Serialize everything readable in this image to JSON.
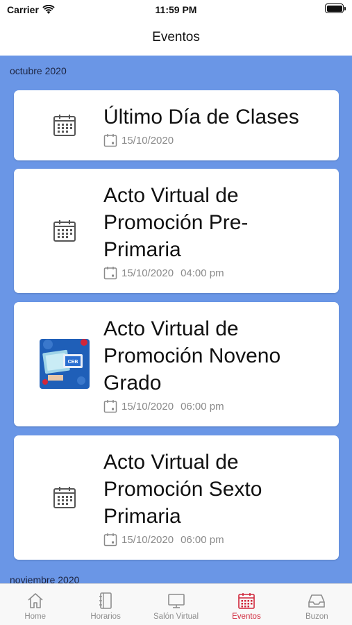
{
  "status_bar": {
    "carrier": "Carrier",
    "time": "11:59 PM"
  },
  "nav": {
    "title": "Eventos"
  },
  "colors": {
    "list_background": "#6a96e6",
    "active_tab": "#d0263a",
    "inactive_tab": "#8e8e8e"
  },
  "sections": [
    {
      "title": "octubre 2020"
    },
    {
      "title": "noviembre 2020"
    }
  ],
  "events": [
    {
      "title": "Último Día de Clases",
      "date": "15/10/2020",
      "time": "",
      "icon": "calendar-icon"
    },
    {
      "title": "Acto Virtual de Promoción Pre-Primaria",
      "date": "15/10/2020",
      "time": "04:00 pm",
      "icon": "calendar-icon"
    },
    {
      "title": "Acto Virtual de Promoción Noveno Grado",
      "date": "15/10/2020",
      "time": "06:00 pm",
      "icon": "event-image-thumbnail",
      "thumb_text": "CEB"
    },
    {
      "title": "Acto Virtual de Promoción Sexto Primaria",
      "date": "15/10/2020",
      "time": "06:00 pm",
      "icon": "calendar-icon"
    }
  ],
  "tabs": [
    {
      "label": "Home",
      "icon": "home-icon",
      "active": false
    },
    {
      "label": "Horarios",
      "icon": "notebook-icon",
      "active": false
    },
    {
      "label": "Salón Virtual",
      "icon": "monitor-icon",
      "active": false
    },
    {
      "label": "Eventos",
      "icon": "calendar-icon",
      "active": true
    },
    {
      "label": "Buzon",
      "icon": "inbox-icon",
      "active": false
    }
  ]
}
